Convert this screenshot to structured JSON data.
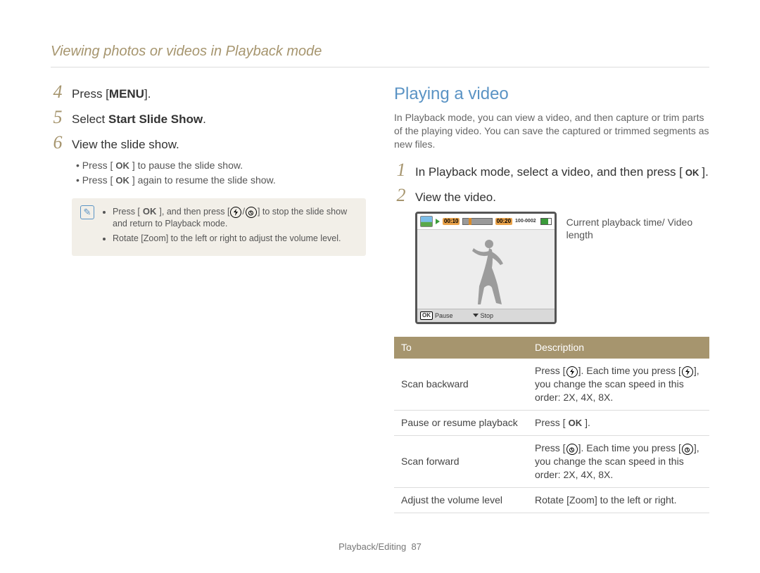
{
  "breadcrumb": "Viewing photos or videos in Playback mode",
  "left": {
    "steps": [
      {
        "num": "4",
        "prefix": "Press [",
        "bold": "MENU",
        "suffix": "]."
      },
      {
        "num": "5",
        "prefix": "Select ",
        "bold": "Start Slide Show",
        "suffix": "."
      },
      {
        "num": "6",
        "prefix": "View the slide show.",
        "bold": "",
        "suffix": ""
      }
    ],
    "sub": [
      {
        "pre": "Press [",
        "key": "OK",
        "post": "] to pause the slide show."
      },
      {
        "pre": "Press [",
        "key": "OK",
        "post": "] again to resume the slide show."
      }
    ],
    "note": [
      "Press [OK], and then press [ ⚡ / ⟳ ] to stop the slide show and return to Playback mode.",
      "Rotate [Zoom] to the left or right to adjust the volume level."
    ]
  },
  "right": {
    "heading": "Playing a video",
    "intro": "In Playback mode, you can view a video, and then capture or trim parts of the playing video. You can save the captured or trimmed segments as new files.",
    "steps": [
      {
        "num": "1",
        "text": "In Playback mode, select a video, and then press [",
        "key": "OK",
        "post": "]."
      },
      {
        "num": "2",
        "text": "View the video.",
        "key": "",
        "post": ""
      }
    ],
    "caption": "Current playback time/ Video length",
    "screen": {
      "t1": "00:10",
      "t2": "00:20",
      "counter": "100-0002",
      "pause": "Pause",
      "stop": "Stop"
    },
    "table": {
      "head": [
        "To",
        "Description"
      ],
      "rows": [
        {
          "to": "Scan backward",
          "desc_pre": "Press [",
          "icon": "flash",
          "desc_mid": "]. Each time you press [",
          "icon2": "flash",
          "desc_post": "], you change the scan speed in this order: 2X, 4X, 8X."
        },
        {
          "to": "Pause or resume playback",
          "desc_pre": "Press [",
          "icon": "ok",
          "desc_mid": "",
          "icon2": "",
          "desc_post": "]."
        },
        {
          "to": "Scan forward",
          "desc_pre": "Press [",
          "icon": "timer",
          "desc_mid": "]. Each time you press [",
          "icon2": "timer",
          "desc_post": "], you change the scan speed in this order: 2X, 4X, 8X."
        },
        {
          "to": "Adjust the volume level",
          "desc_pre": "Rotate [",
          "icon": "",
          "desc_mid": "",
          "icon2": "",
          "desc_post": "Zoom] to the left or right.",
          "bold_in_post": "Zoom"
        }
      ]
    }
  },
  "footer": {
    "section": "Playback/Editing",
    "page": "87"
  }
}
